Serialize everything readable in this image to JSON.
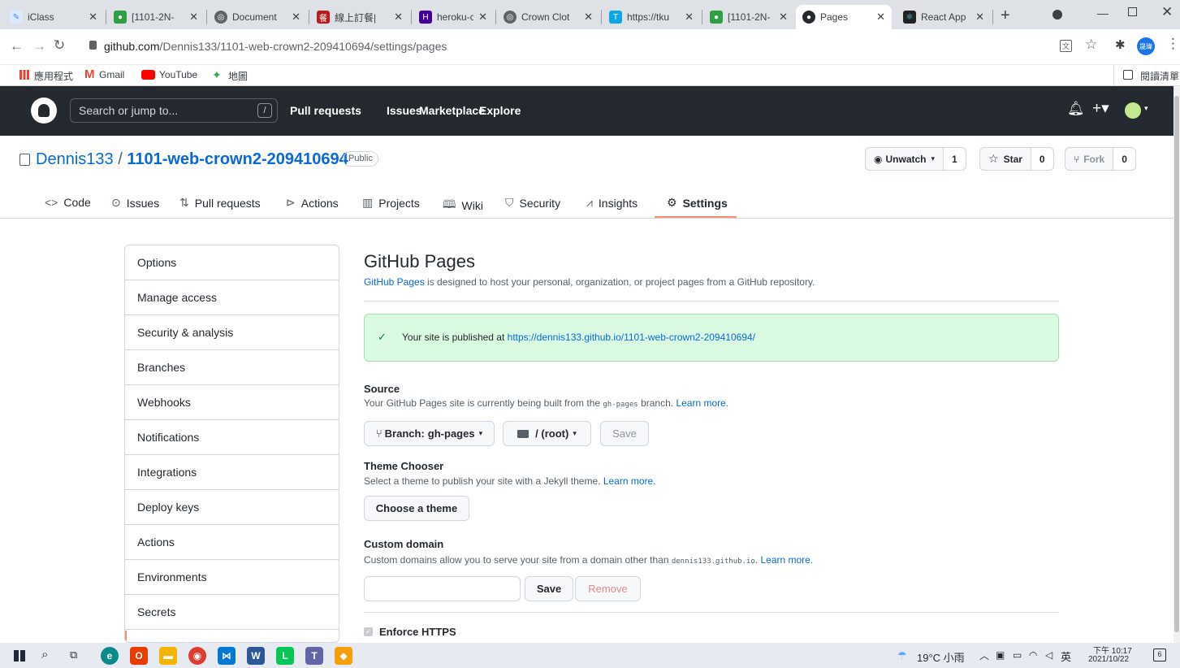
{
  "browser": {
    "tabs": [
      {
        "title": "iClass",
        "favicon_color": "#3b82f6"
      },
      {
        "title": "[1101-2N-",
        "favicon_color": "#2ea043"
      },
      {
        "title": "Document",
        "favicon_color": "#5f6368"
      },
      {
        "title": "線上訂餐|",
        "favicon_color": "#b91c1c"
      },
      {
        "title": "heroku-cro",
        "favicon_color": "#430098"
      },
      {
        "title": "Crown Clot",
        "favicon_color": "#5f6368"
      },
      {
        "title": "https://tku",
        "favicon_color": "#0ea5e9"
      },
      {
        "title": "[1101-2N-",
        "favicon_color": "#2ea043"
      },
      {
        "title": "Pages",
        "favicon_color": "#24292f"
      },
      {
        "title": "React App",
        "favicon_color": "#222222"
      }
    ],
    "new_tab": "+",
    "url_host": "github.com",
    "url_path": "/Dennis133/1101-web-crown2-209410694/settings/pages",
    "profile_initials": "晟瑋",
    "bookmarks": [
      {
        "label": "應用程式"
      },
      {
        "label": "Gmail"
      },
      {
        "label": "YouTube"
      },
      {
        "label": "地圖"
      }
    ],
    "reading_list": "閱讀清單"
  },
  "github": {
    "search_placeholder": "Search or jump to...",
    "search_key": "/",
    "nav": [
      "Pull requests",
      "Issues",
      "Marketplace",
      "Explore"
    ],
    "repo_owner": "Dennis133",
    "repo_sep": "/",
    "repo_name": "1101-web-crown2-209410694",
    "visibility": "Public",
    "watch_label": "Unwatch",
    "watch_count": "1",
    "star_label": "Star",
    "star_count": "0",
    "fork_label": "Fork",
    "fork_count": "0",
    "repo_tabs": [
      "Code",
      "Issues",
      "Pull requests",
      "Actions",
      "Projects",
      "Wiki",
      "Security",
      "Insights",
      "Settings"
    ],
    "sidebar": [
      "Options",
      "Manage access",
      "Security & analysis",
      "Branches",
      "Webhooks",
      "Notifications",
      "Integrations",
      "Deploy keys",
      "Actions",
      "Environments",
      "Secrets"
    ]
  },
  "pages": {
    "heading": "GitHub Pages",
    "intro_link": "GitHub Pages",
    "intro_text": " is designed to host your personal, organization, or project pages from a GitHub repository.",
    "published_text": "Your site is published at ",
    "published_url": "https://dennis133.github.io/1101-web-crown2-209410694/",
    "source_title": "Source",
    "source_text_1": "Your GitHub Pages site is currently being built from the ",
    "source_branch_code": "gh-pages",
    "source_text_2": " branch. ",
    "learn_more": "Learn more.",
    "branch_label": "Branch:",
    "branch_value": "gh-pages",
    "folder_value": "/ (root)",
    "save_label": "Save",
    "theme_title": "Theme Chooser",
    "theme_text": "Select a theme to publish your site with a Jekyll theme. ",
    "choose_theme": "Choose a theme",
    "domain_title": "Custom domain",
    "domain_text_1": "Custom domains allow you to serve your site from a domain other than ",
    "domain_code": "dennis133.github.io",
    "domain_text_2": ". ",
    "domain_input_value": "",
    "remove_label": "Remove",
    "https_label": "Enforce HTTPS"
  },
  "taskbar": {
    "weather": "19°C 小雨",
    "ime": "英",
    "time": "下午 10:17",
    "date": "2021/10/22",
    "notif_count": "6"
  }
}
